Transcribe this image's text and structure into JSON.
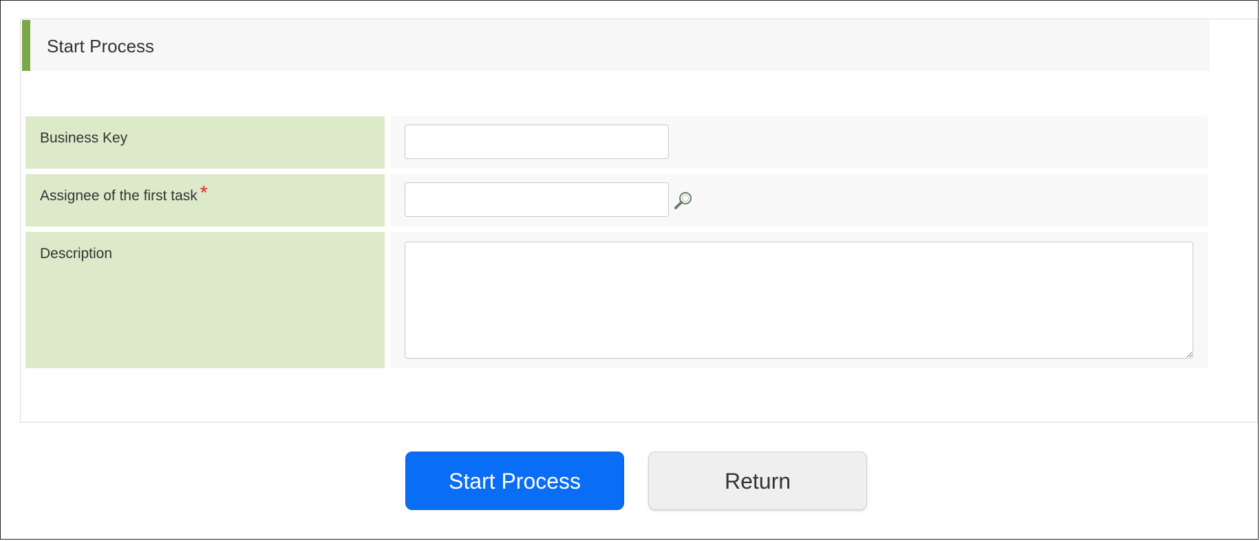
{
  "panel": {
    "title": "Start Process"
  },
  "form": {
    "business_key": {
      "label": "Business Key",
      "value": ""
    },
    "assignee": {
      "label": "Assignee of the first task",
      "required_mark": "*",
      "value": ""
    },
    "description": {
      "label": "Description",
      "value": ""
    }
  },
  "actions": {
    "start_label": "Start Process",
    "return_label": "Return"
  },
  "icons": {
    "assignee_lookup": "search-icon"
  },
  "colors": {
    "accent": "#7aa847",
    "label_background": "#ddeaca",
    "primary_button": "#0a6df5",
    "required": "#e41f1f"
  }
}
